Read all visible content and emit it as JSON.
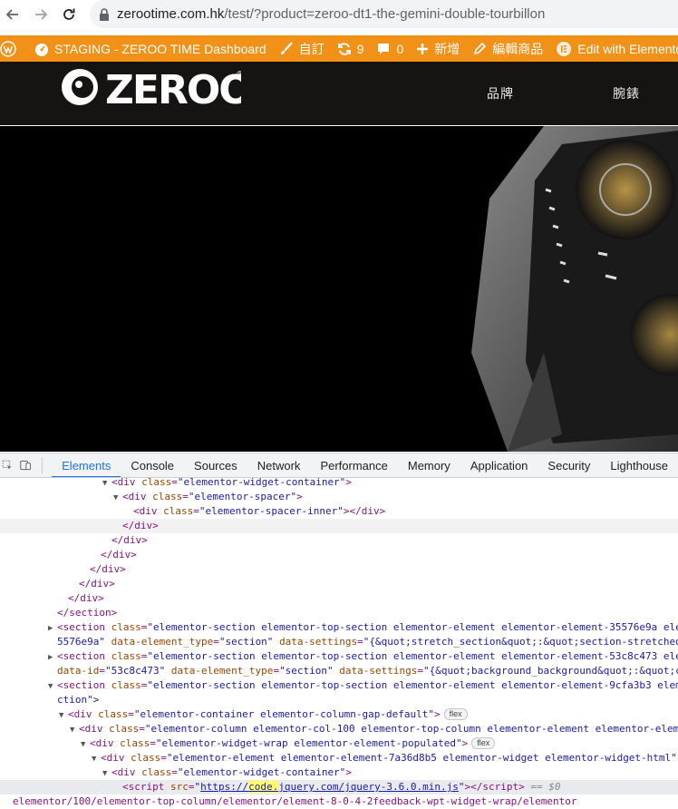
{
  "browser": {
    "host": "zerootime.com.hk",
    "path": "/test/?product=zeroo-dt1-the-gemini-double-tourbillon"
  },
  "adminbar": {
    "site_label": "STAGING - ZEROO TIME Dashboard",
    "customize_label": "自訂",
    "updates_count": "9",
    "comments_count": "0",
    "new_label": "新增",
    "edit_product_label": "編輯商品",
    "elementor_label": "Edit with Elementor"
  },
  "site": {
    "logo_text": "ZEROO",
    "logo_mark": "®",
    "menu": [
      "品牌",
      "腕錶"
    ]
  },
  "devtools": {
    "tabs": [
      "Elements",
      "Console",
      "Sources",
      "Network",
      "Performance",
      "Memory",
      "Application",
      "Security",
      "Lighthouse"
    ],
    "active_tab": "Elements",
    "script_src_prefix": "https://",
    "script_src_highlight": "code.",
    "script_src_rest": "jquery.com/jquery-3.6.0.min.js",
    "selected_marker": "== $0",
    "badge_flex": "flex",
    "nodes": {
      "l1_tag": "<div",
      "l1_attr": "class",
      "l1_val": "\"elementor-widget-container\"",
      "l2_val": "\"elementor-spacer\"",
      "l3_val": "\"elementor-spacer-inner\"",
      "close_div": "</div>",
      "close_section": "</section>",
      "sec1_line1_val": "\"elementor-section elementor-top-section elementor-element elementor-element-35576e9a ele",
      "sec1_line2_a": "5576e9a\"",
      "sec1_line2_b": "\"section\"",
      "sec1_line2_c": "\"{&quot;stretch_section&quot;:&quot;section-stretched",
      "sec2_line1_val": "\"elementor-section elementor-top-section elementor-element elementor-element-53c8c473 ele",
      "sec2_line2_a": "\"53c8c473\"",
      "sec2_line2_b": "\"section\"",
      "sec2_line2_c": "\"{&quot;background_background&quot;:&quot;c",
      "sec3_line1_val": "\"elementor-section elementor-top-section elementor-element elementor-element-9cfa3b3 elem",
      "sec3_line2": "ction\">",
      "container_val": "\"elementor-container elementor-column-gap-default\"",
      "column_val": "\"elementor-column elementor-col-100 elementor-top-column elementor-element elementor-elem",
      "wrap_val": "\"elementor-widget-wrap elementor-element-populated\"",
      "element_val": "\"elementor-element elementor-element-7a36d8b5 elementor-widget elementor-widget-html\"",
      "widget_container_val": "\"elementor-widget-container\"",
      "last_line": "elementor/100/elementor-top-column/elementor/element-8-0-4-2feedback-wpt-widget-wrap/elementor"
    }
  }
}
